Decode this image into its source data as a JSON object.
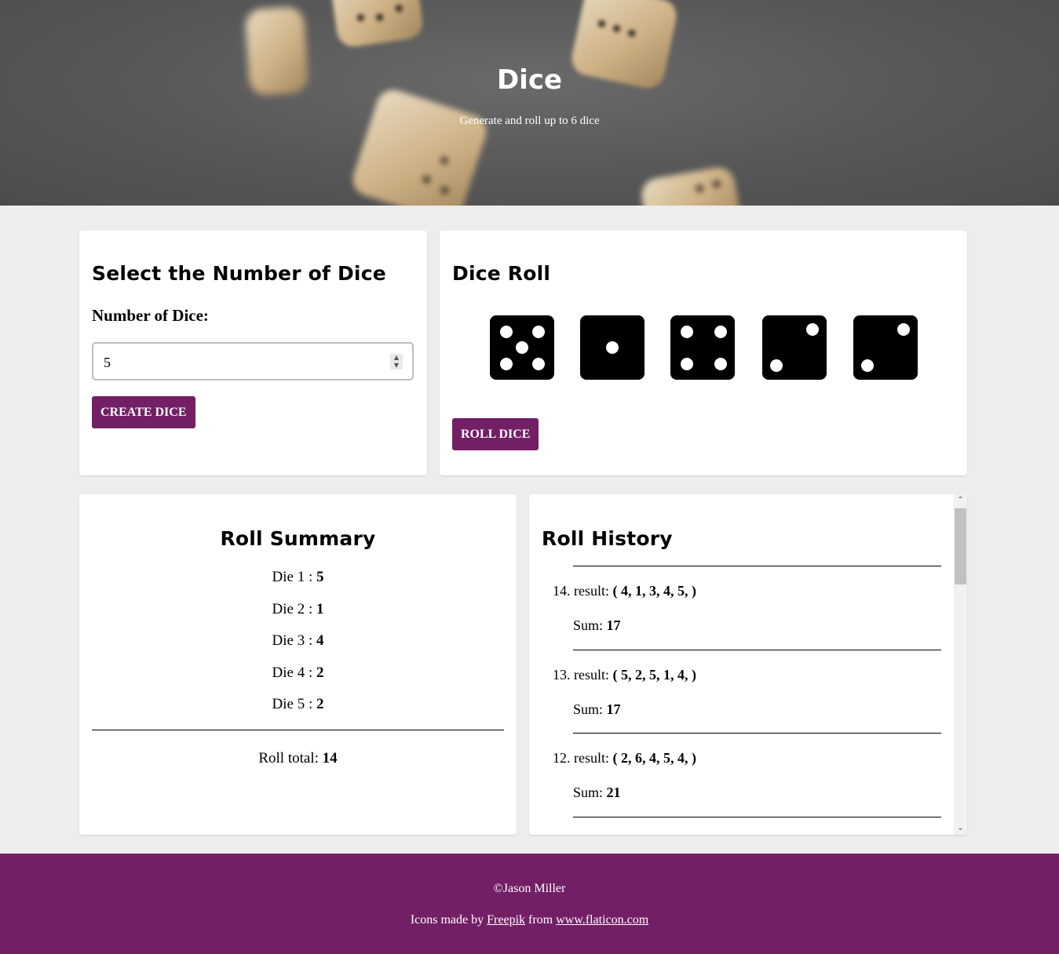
{
  "hero": {
    "title": "Dice",
    "subtitle": "Generate and roll up to 6 dice"
  },
  "select_card": {
    "heading": "Select the Number of Dice",
    "label": "Number of Dice:",
    "input_value": "5",
    "button_label": "CREATE DICE"
  },
  "roll_card": {
    "heading": "Dice Roll",
    "dice_values": [
      5,
      1,
      4,
      2,
      2
    ],
    "button_label": "ROLL DICE"
  },
  "summary": {
    "heading": "Roll Summary",
    "dice": [
      {
        "label": "Die 1 :",
        "value": "5"
      },
      {
        "label": "Die 2 :",
        "value": "1"
      },
      {
        "label": "Die 3 :",
        "value": "4"
      },
      {
        "label": "Die 4 :",
        "value": "2"
      },
      {
        "label": "Die 5 :",
        "value": "2"
      }
    ],
    "total_label": "Roll total:",
    "total_value": "14"
  },
  "history": {
    "heading": "Roll History",
    "entries": [
      {
        "number": "14.",
        "result_label": "result:",
        "result": "( 4, 1, 3, 4, 5, )",
        "sum_label": "Sum:",
        "sum": "17"
      },
      {
        "number": "13.",
        "result_label": "result:",
        "result": "( 5, 2, 5, 1, 4, )",
        "sum_label": "Sum:",
        "sum": "17"
      },
      {
        "number": "12.",
        "result_label": "result:",
        "result": "( 2, 6, 4, 5, 4, )",
        "sum_label": "Sum:",
        "sum": "21"
      }
    ]
  },
  "footer": {
    "copyright": "©Jason Miller",
    "credit_prefix": "Icons made by",
    "credit_author": "Freepik",
    "credit_middle": "from",
    "credit_site": "www.flaticon.com"
  },
  "colors": {
    "accent": "#721f65",
    "page_background": "#eceded"
  }
}
